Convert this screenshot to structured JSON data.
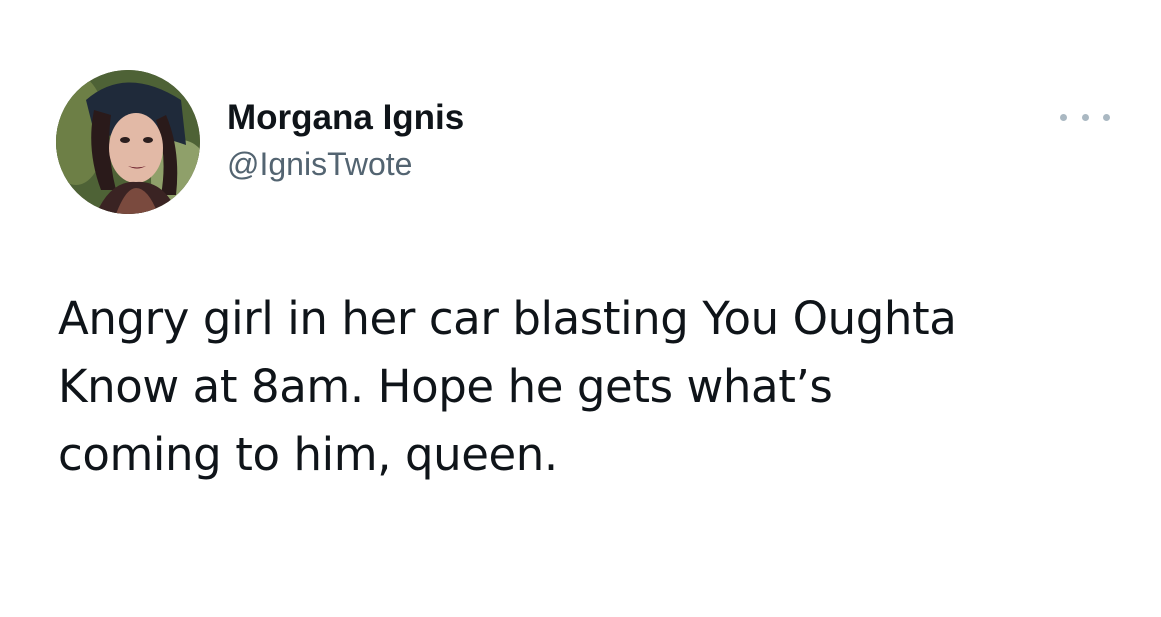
{
  "tweet": {
    "display_name": "Morgana Ignis",
    "handle": "@IgnisTwote",
    "text_lines": [
      "Angry girl in her car blasting You Oughta",
      "Know at 8am. Hope he gets what’s",
      "coming to him, queen."
    ]
  },
  "icons": {
    "avatar": "profile-photo",
    "more": "more-horizontal-icon"
  },
  "colors": {
    "text": "#0f1419",
    "handle": "#536471",
    "more_dots": "#aab8c2",
    "background": "#ffffff"
  }
}
